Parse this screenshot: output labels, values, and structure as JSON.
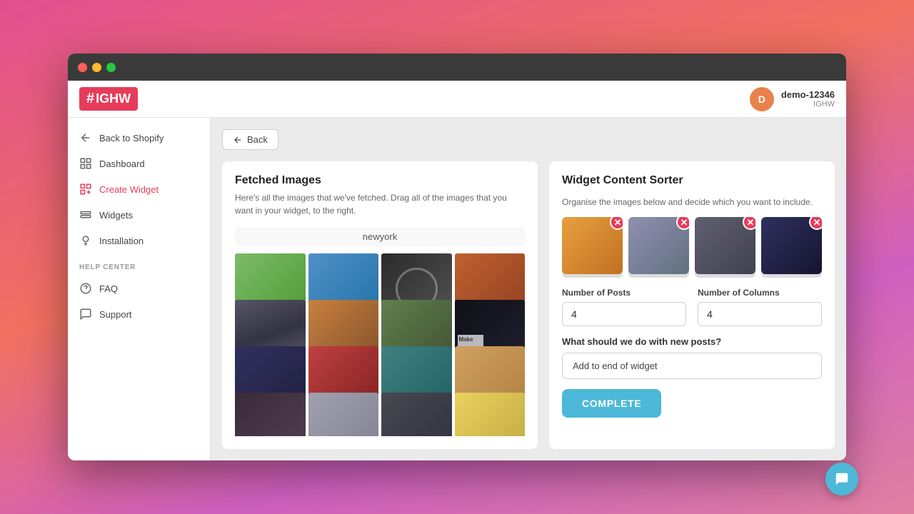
{
  "browser": {
    "dots": [
      "red",
      "yellow",
      "green"
    ]
  },
  "header": {
    "logo_hash": "#",
    "logo_brand": "IGHW",
    "user_initials": "D",
    "user_name": "demo-12346",
    "user_sub": "IGHW"
  },
  "sidebar": {
    "nav_items": [
      {
        "id": "back-to-shopify",
        "label": "Back to Shopify",
        "icon": "arrow-left"
      },
      {
        "id": "dashboard",
        "label": "Dashboard",
        "icon": "grid"
      },
      {
        "id": "create-widget",
        "label": "Create Widget",
        "icon": "plus-grid",
        "active": true
      },
      {
        "id": "widgets",
        "label": "Widgets",
        "icon": "stack"
      },
      {
        "id": "installation",
        "label": "Installation",
        "icon": "bulb"
      }
    ],
    "help_section_label": "HELP CENTER",
    "help_items": [
      {
        "id": "faq",
        "label": "FAQ",
        "icon": "question"
      },
      {
        "id": "support",
        "label": "Support",
        "icon": "chat"
      }
    ]
  },
  "back_button_label": "Back",
  "left_panel": {
    "title": "Fetched Images",
    "description": "Here's all the images that we've fetched. Drag all of the images that you want in your widget, to the right.",
    "tag": "newyork",
    "images": [
      {
        "id": 1,
        "cls": "fake-img-1"
      },
      {
        "id": 2,
        "cls": "fake-img-2"
      },
      {
        "id": 3,
        "cls": "fake-img-3"
      },
      {
        "id": 4,
        "cls": "fake-img-4"
      },
      {
        "id": 5,
        "cls": "fake-img-5"
      },
      {
        "id": 6,
        "cls": "fake-img-6"
      },
      {
        "id": 7,
        "cls": "fake-img-7"
      },
      {
        "id": 8,
        "cls": "fake-img-8"
      },
      {
        "id": 9,
        "cls": "fake-img-9"
      },
      {
        "id": 10,
        "cls": "fake-img-10"
      },
      {
        "id": 11,
        "cls": "fake-img-11"
      },
      {
        "id": 12,
        "cls": "fake-img-12"
      }
    ]
  },
  "right_panel": {
    "title": "Widget Content Sorter",
    "description": "Organise the images below and decide which you want to include.",
    "selected_images": [
      {
        "id": 1,
        "cls": "fake-img-sel-1"
      },
      {
        "id": 2,
        "cls": "fake-img-sel-2"
      },
      {
        "id": 3,
        "cls": "fake-img-sel-3"
      },
      {
        "id": 4,
        "cls": "fake-img-sel-4"
      }
    ],
    "num_posts_label": "Number of Posts",
    "num_posts_value": "4",
    "num_columns_label": "Number of Columns",
    "num_columns_value": "4",
    "new_posts_question": "What should we do with new posts?",
    "new_posts_option": "Add to end of widget",
    "complete_button_label": "COMPLETE"
  },
  "chat_button_icon": "💬"
}
